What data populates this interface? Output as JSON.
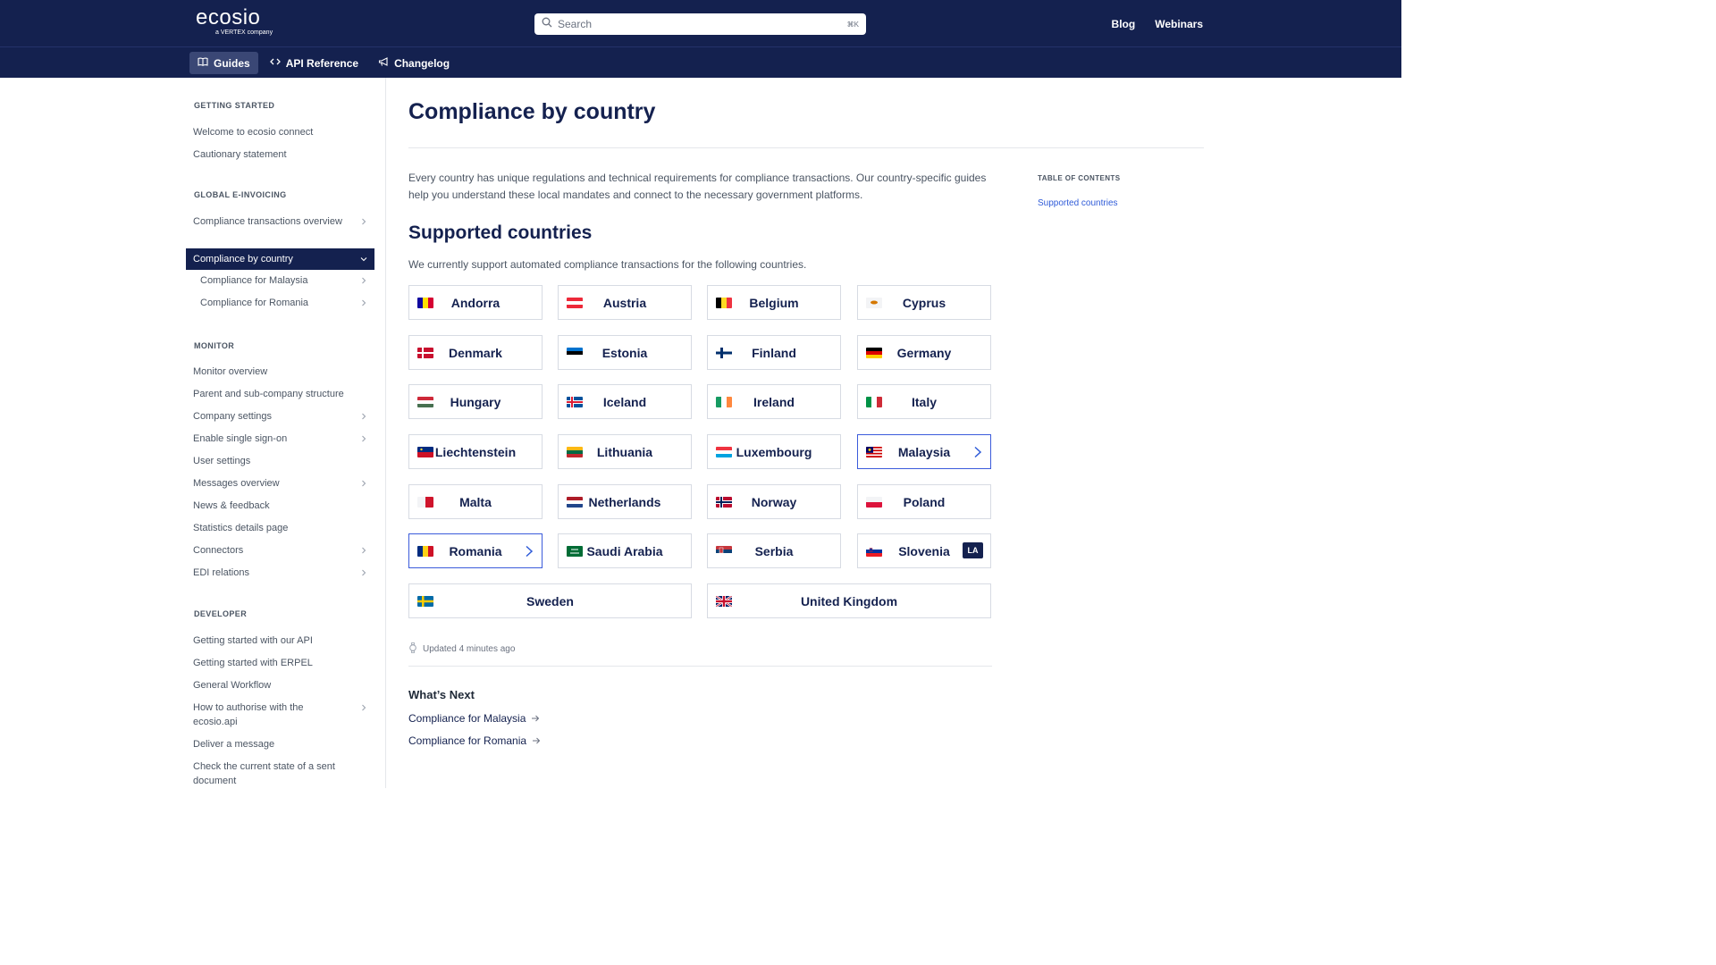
{
  "header": {
    "logo": "ecosio",
    "logo_sub": "a VERTEX company",
    "search_placeholder": "Search",
    "search_shortcut": "⌘K",
    "links": [
      "Blog",
      "Webinars"
    ]
  },
  "subnav": {
    "tabs": [
      {
        "label": "Guides",
        "icon": "book-icon",
        "active": true
      },
      {
        "label": "API Reference",
        "icon": "code-icon",
        "active": false
      },
      {
        "label": "Changelog",
        "icon": "megaphone-icon",
        "active": false
      }
    ]
  },
  "sidebar": {
    "sections": [
      {
        "title": "GETTING STARTED"
      },
      {
        "title": "GLOBAL E-INVOICING"
      },
      {
        "title": "MONITOR"
      },
      {
        "title": "DEVELOPER"
      }
    ],
    "items": [
      {
        "label": "Welcome to ecosio connect"
      },
      {
        "label": "Cautionary statement"
      },
      {
        "label": "Compliance transactions overview"
      },
      {
        "label": "Compliance by country"
      },
      {
        "label": "Compliance for Malaysia"
      },
      {
        "label": "Compliance for Romania"
      },
      {
        "label": "Monitor overview"
      },
      {
        "label": "Parent and sub-company structure"
      },
      {
        "label": "Company settings"
      },
      {
        "label": "Enable single sign-on"
      },
      {
        "label": "User settings"
      },
      {
        "label": "Messages overview"
      },
      {
        "label": "News & feedback"
      },
      {
        "label": "Statistics details page"
      },
      {
        "label": "Connectors"
      },
      {
        "label": "EDI relations"
      },
      {
        "label": "Getting started with our API"
      },
      {
        "label": "Getting started with ERPEL"
      },
      {
        "label": "General Workflow"
      },
      {
        "label": "How to authorise with the ecosio.api"
      },
      {
        "label": "Deliver a message"
      },
      {
        "label": "Check the current state of a sent document"
      }
    ]
  },
  "main": {
    "title": "Compliance by country",
    "intro": "Every country has unique regulations and technical requirements for compliance transactions. Our country-specific guides help you understand these local mandates and connect to the necessary government platforms.",
    "supported_heading": "Supported countries",
    "supported_lead": "We currently support automated compliance transactions for the following countries.",
    "countries": [
      {
        "name": "Andorra"
      },
      {
        "name": "Austria"
      },
      {
        "name": "Belgium"
      },
      {
        "name": "Cyprus"
      },
      {
        "name": "Denmark"
      },
      {
        "name": "Estonia"
      },
      {
        "name": "Finland"
      },
      {
        "name": "Germany"
      },
      {
        "name": "Hungary"
      },
      {
        "name": "Iceland"
      },
      {
        "name": "Ireland"
      },
      {
        "name": "Italy"
      },
      {
        "name": "Liechtenstein"
      },
      {
        "name": "Lithuania"
      },
      {
        "name": "Luxembourg"
      },
      {
        "name": "Malaysia"
      },
      {
        "name": "Malta"
      },
      {
        "name": "Netherlands"
      },
      {
        "name": "Norway"
      },
      {
        "name": "Poland"
      },
      {
        "name": "Romania"
      },
      {
        "name": "Saudi Arabia"
      },
      {
        "name": "Serbia"
      },
      {
        "name": "Slovenia",
        "badge": "LA"
      },
      {
        "name": "Sweden"
      },
      {
        "name": "United Kingdom"
      }
    ],
    "updated": "Updated 4 minutes ago",
    "whats_next": {
      "heading": "What’s Next",
      "links": [
        "Compliance for Malaysia",
        "Compliance for Romania"
      ]
    }
  },
  "toc": {
    "heading": "TABLE OF CONTENTS",
    "links": [
      "Supported countries"
    ]
  },
  "colors": {
    "header_bg": "#14214f",
    "accent": "#2f5bd8",
    "active_tab": "#3a4775"
  }
}
